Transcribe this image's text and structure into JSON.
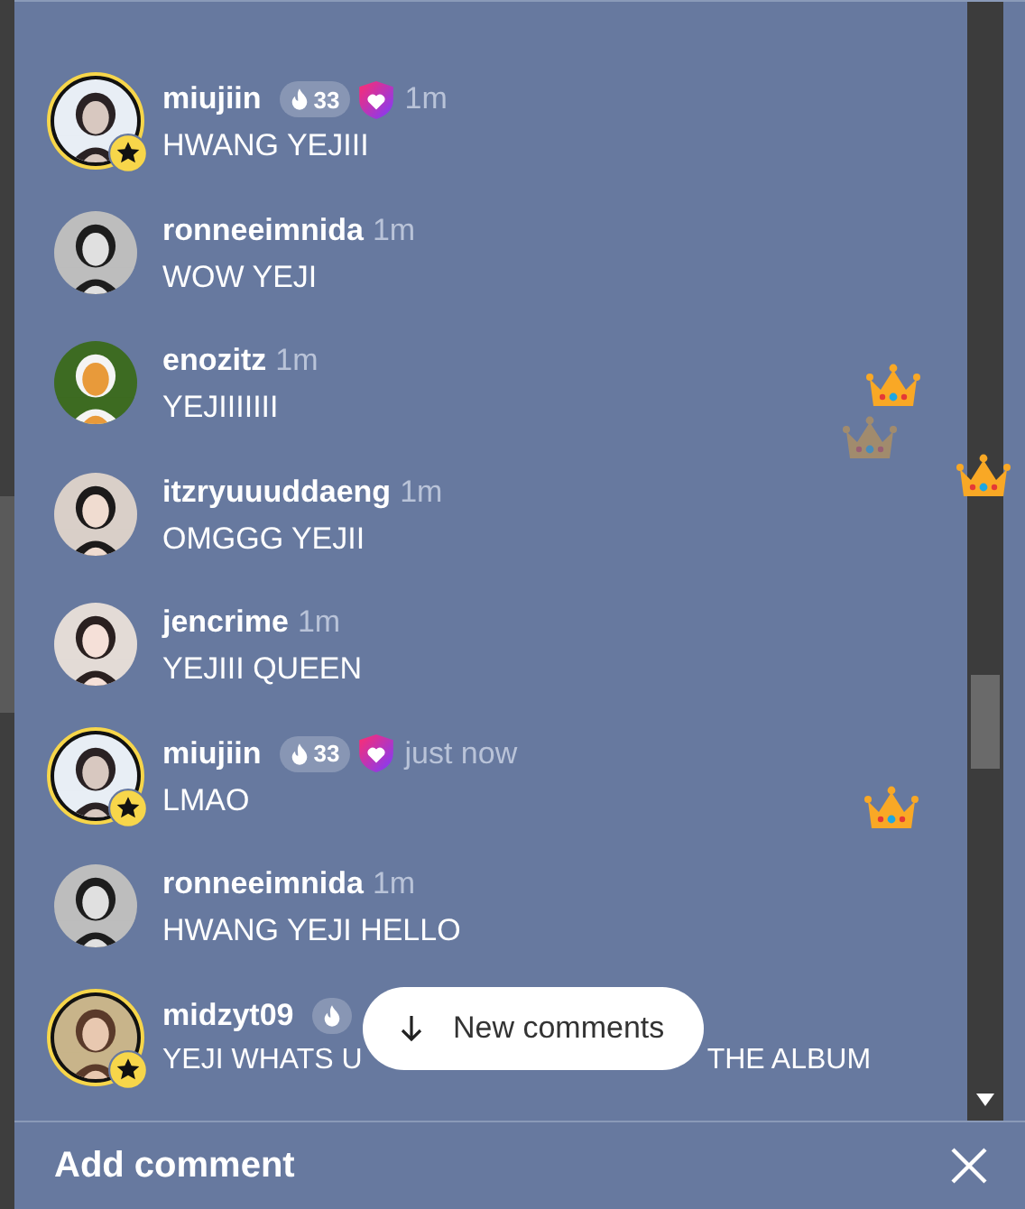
{
  "comments": [
    {
      "username": "miujiin",
      "highlighted": true,
      "streak_badge": true,
      "streak": "33",
      "shield": true,
      "time": "1m",
      "message": "HWANG YEJIII"
    },
    {
      "username": "ronneeimnida",
      "highlighted": false,
      "streak_badge": false,
      "shield": false,
      "time": "1m",
      "message": "WOW YEJI"
    },
    {
      "username": "enozitz",
      "highlighted": false,
      "streak_badge": false,
      "shield": false,
      "time": "1m",
      "message": "YEJIIIIIII"
    },
    {
      "username": "itzryuuuddaeng",
      "highlighted": false,
      "streak_badge": false,
      "shield": false,
      "time": "1m",
      "message": "OMGGG YEJII"
    },
    {
      "username": "jencrime",
      "highlighted": false,
      "streak_badge": false,
      "shield": false,
      "time": "1m",
      "message": "YEJIII QUEEN"
    },
    {
      "username": "miujiin",
      "highlighted": true,
      "streak_badge": true,
      "streak": "33",
      "shield": true,
      "time": "just now",
      "message": "LMAO"
    },
    {
      "username": "ronneeimnida",
      "highlighted": false,
      "streak_badge": false,
      "shield": false,
      "time": "1m",
      "message": "HWANG YEJI HELLO"
    },
    {
      "username": "midzyt09",
      "highlighted": true,
      "streak_badge": true,
      "shield": false,
      "message_parts": [
        "YEJI WHATS U",
        "THE ALBUM"
      ]
    }
  ],
  "crowns": [
    {
      "faded": false
    },
    {
      "faded": true
    },
    {
      "faded": false
    },
    {
      "faded": false
    }
  ],
  "new_comments_button": {
    "label": "New comments"
  },
  "footer": {
    "title": "Add comment"
  }
}
